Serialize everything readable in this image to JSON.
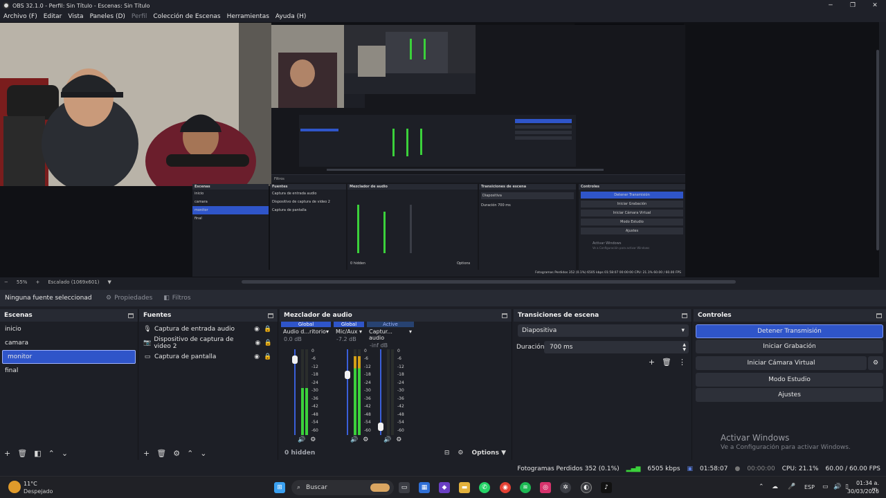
{
  "window": {
    "title": "OBS 32.1.0 - Perfil: Sin Título - Escenas: Sin Título",
    "controls": [
      "─",
      "❐",
      "✕"
    ]
  },
  "menu": {
    "items": [
      {
        "label": "Archivo (F)",
        "enabled": true
      },
      {
        "label": "Editar",
        "enabled": true
      },
      {
        "label": "Vista",
        "enabled": true
      },
      {
        "label": "Paneles (D)",
        "enabled": true
      },
      {
        "label": "Perfil",
        "enabled": false
      },
      {
        "label": "Colección de Escenas",
        "enabled": true
      },
      {
        "label": "Herramientas",
        "enabled": true
      },
      {
        "label": "Ayuda (H)",
        "enabled": true
      }
    ]
  },
  "preview_controls": {
    "zoom_minus": "−",
    "zoom": "55%",
    "zoom_plus": "+",
    "scale_mode": "Escalado (1069x601)"
  },
  "source_toolbar": {
    "no_source": "Ninguna fuente seleccionad",
    "properties": "Propiedades",
    "filters": "Filtros"
  },
  "scenes": {
    "title": "Escenas",
    "items": [
      "inicio",
      "camara",
      "monitor",
      "final"
    ],
    "selected": "monitor"
  },
  "sources": {
    "title": "Fuentes",
    "items": [
      {
        "label": "Captura de entrada audio",
        "icon": "microphone-icon"
      },
      {
        "label": "Dispositivo de captura de video 2",
        "icon": "camera-icon"
      },
      {
        "label": "Captura de pantalla",
        "icon": "monitor-icon"
      }
    ]
  },
  "mixer": {
    "title": "Mezclador de audio",
    "channels": [
      {
        "tag": "Global",
        "name": "Audio d...ritorio",
        "db": "0.0 dB",
        "active": false,
        "fader_level": 0.92,
        "meter_level": 0.55
      },
      {
        "tag": "Global",
        "name": "Mic/Aux",
        "db": "-7.2 dB",
        "active": false,
        "fader_level": 0.72,
        "meter_level": 0.92
      },
      {
        "tag": "Active",
        "name": "Captur... audio",
        "db": "-inf dB",
        "active": true,
        "fader_level": 0.05,
        "meter_level": 0.0
      }
    ],
    "scale": [
      "0",
      "-6",
      "-12",
      "-18",
      "-24",
      "-30",
      "-36",
      "-42",
      "-48",
      "-54",
      "-60"
    ],
    "hidden": "0 hidden",
    "options": "Options"
  },
  "transitions": {
    "title": "Transiciones de escena",
    "selected": "Diapositiva",
    "duration_label": "Duración",
    "duration": "700 ms"
  },
  "controls": {
    "title": "Controles",
    "buttons": [
      "Detener Transmisión",
      "Iniciar Grabación",
      "Iniciar Cámara Virtual",
      "Modo Estudio",
      "Ajustes"
    ]
  },
  "watermark": {
    "line1": "Activar Windows",
    "line2": "Ve a Configuración para activar Windows."
  },
  "status": {
    "dropped_frames": "Fotogramas Perdidos 352 (0.1%)",
    "bitrate": "6505 kbps",
    "stream_time": "01:58:07",
    "record_time": "00:00:00",
    "cpu": "CPU: 21.1%",
    "fps": "60.00 / 60.00 FPS"
  },
  "taskbar": {
    "weather_temp": "11°C",
    "weather_desc": "Despejado",
    "search": "Buscar",
    "lang": "ESP",
    "time": "01:34 a. m.",
    "date": "30/03/2026"
  },
  "nested_preview": {
    "scenes_title": "Escenas",
    "sources_title": "Fuentes",
    "mixer_title": "Mezclador de audio",
    "transitions_title": "Transiciones de escena",
    "controls_title": "Controles",
    "scene_items": [
      "inicio",
      "camara",
      "monitor",
      "final"
    ],
    "source_items": [
      "Captura de entrada audio",
      "Dispositivo de captura de video 2",
      "Captura de pantalla"
    ],
    "transition": "Diapositiva",
    "duration_label": "Duración",
    "duration": "700 ms",
    "buttons": [
      "Detener Transmisión",
      "Iniciar Grabación",
      "Iniciar Cámara Virtual",
      "Modo Estudio",
      "Ajustes"
    ],
    "hidden": "0 hidden",
    "options": "Options",
    "filters": "Filtros",
    "watermark1": "Activar Windows",
    "watermark2": "Ve a Configuración para activar Windows",
    "status": "Fotogramas Perdidos 352 (0.1%)   6505 kbps   01:58:07   00:00:00   CPU: 21.1%   60.00 / 60.00 FPS"
  },
  "colors": {
    "accent": "#2f55c9",
    "panel": "#1d1f26",
    "header": "#272a33",
    "meter_green": "#3bd13b",
    "meter_yellow": "#d4a017",
    "meter_red": "#c8102e"
  }
}
